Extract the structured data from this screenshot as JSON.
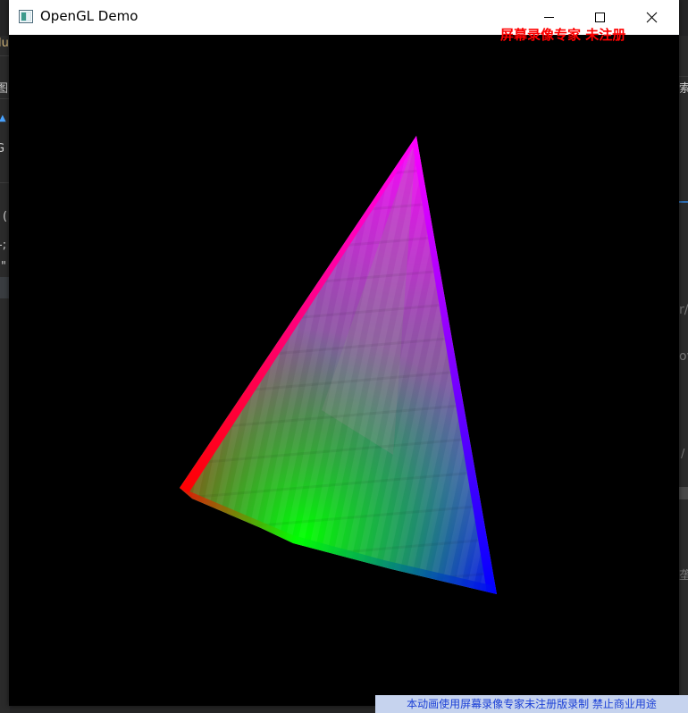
{
  "window": {
    "title": "OpenGL Demo",
    "icon": "opengl-app-icon",
    "controls": {
      "minimize_icon": "minimize-icon",
      "maximize_icon": "maximize-icon",
      "close_icon": "close-icon"
    }
  },
  "watermarks": {
    "top_right": "屏幕录像专家 未注册",
    "bottom": "本动画使用屏幕录像专家未注册版录制  禁止商业用途"
  },
  "scene": {
    "description_shape": "cone",
    "vertex_colors": {
      "apex": "#ff00ff",
      "left": "#ff0000",
      "front": "#00ff00",
      "right": "#0000ff"
    },
    "background_color": "#000000"
  },
  "background_app": {
    "left_glyphs": [
      "lu",
      "图",
      "G",
      "(",
      "-;",
      "\""
    ],
    "right_glyphs": [
      "索",
      "r/",
      "ov",
      "/",
      "垄"
    ]
  }
}
